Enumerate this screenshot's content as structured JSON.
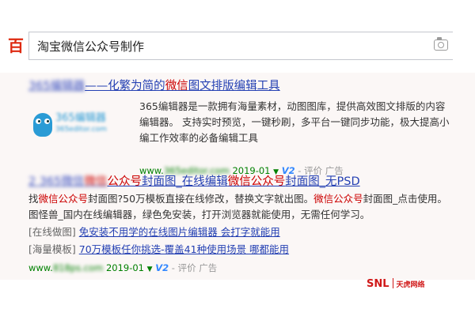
{
  "search": {
    "logo_text": "百度",
    "query": "淘宝微信公众号制作"
  },
  "result1": {
    "title_blurred": "365编辑器",
    "title_dash": "——化繁为简的",
    "title_hl": "微信",
    "title_rest": "图文排版编辑工具",
    "thumb_text": "365编辑器",
    "thumb_sub": "365editor.com",
    "description": "365编辑器是一款拥有海量素材，动图图库，提供高效图文排版的内容编辑器。 支持实时预览，一键秒刷，多平台一键同步功能，极大提高小编工作效率的必备编辑工具",
    "url_prefix": "www.",
    "url_blurred": "365editor.com",
    "date": "2019-01",
    "v2": "V2",
    "sep": " - ",
    "evaluate": "评价",
    "ad": "广告"
  },
  "result2": {
    "title_blurred_1": "2 365微信",
    "title_blurred_2": "微信",
    "title_p1": "公众号",
    "title_p2": "封面图_在线编辑",
    "title_p3": "微信公众号",
    "title_p4": "封面图_无PSD",
    "desc_1": "找",
    "desc_2": "微信公众号",
    "desc_3": "封面图?50万模板直接在线修改，替换文字就出图。",
    "desc_4": "微信公众号",
    "desc_5": "封面图_点击使用。图怪兽_国内在线编辑器，绿色免安装，打开浏览器就能使用，无需任何学习。",
    "sub1_label": "[在线做图]",
    "sub1_link": "免安装不用学的在线图片编辑器 会打字就能用",
    "sub2_label": "[海量模板]",
    "sub2_link": "70万模板任你挑选-覆盖41种使用场景 哪都能用",
    "url_prefix": "www.",
    "url_blurred": "818ps.com",
    "date": "2019-01",
    "v2": "V2",
    "sep": " - ",
    "evaluate": "评价",
    "ad": "广告"
  },
  "watermark": {
    "brand": "SNL",
    "name": "天虎网络"
  },
  "colors": {
    "link": "#2440b3",
    "highlight": "#cc0000",
    "url": "#008000",
    "brand_red": "#de2910"
  }
}
